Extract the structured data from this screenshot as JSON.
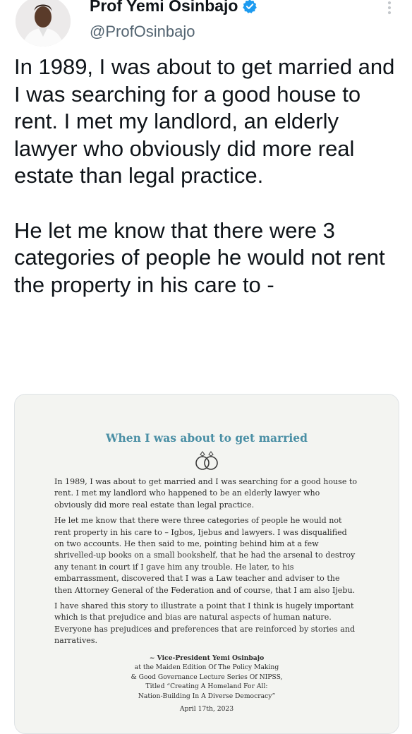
{
  "author": {
    "display_name": "Prof Yemi Osinbajo",
    "handle": "@ProfOsinbajo"
  },
  "tweet": {
    "paragraph_1": "In 1989, I was about to get married and I was searching for a good house to rent. I met my landlord, an elderly lawyer who obviously did more real estate than legal practice.",
    "paragraph_2": "He let me know that there were 3 categories of people he would not rent the property in his care to -"
  },
  "media_card": {
    "title": "When I was about to get married",
    "paragraphs": [
      "In 1989, I was about to get married and I was searching for a good house to rent. I met my landlord who happened to be an elderly lawyer who obviously did more real estate than legal practice.",
      "He let me know that there were three categories of people he would not rent property in his care to – Igbos, Ijebus and lawyers. I was disqualified on two accounts. He then said to me, pointing behind him at a few shrivelled-up books on a small bookshelf, that he had the arsenal to destroy any tenant in court if I gave him any trouble. He later, to his embarrassment, discovered that I was a Law teacher and adviser to the then Attorney General of the Federation and of course, that I am also Ijebu.",
      "I have shared this story to illustrate a point that I think is hugely important which is that prejudice and bias are natural aspects of human nature. Everyone has prejudices and preferences that are reinforced by stories and narratives."
    ],
    "attribution": {
      "name": "~ Vice-President Yemi Osinbajo",
      "line_1": "at the Maiden Edition Of The Policy Making",
      "line_2": "& Good Governance Lecture Series Of NIPSS,",
      "line_3": "Titled “Creating A Homeland For All:",
      "line_4": "Nation-Building In A Diverse Democracy”",
      "date": "April 17th, 2023"
    }
  },
  "icons": {
    "verified": "verified-badge-icon",
    "more": "more-vertical-icon",
    "rings": "wedding-rings-icon"
  },
  "colors": {
    "verified_blue": "#1d9bf0",
    "doc_title": "#4a8fa5",
    "handle_gray": "#536471"
  }
}
